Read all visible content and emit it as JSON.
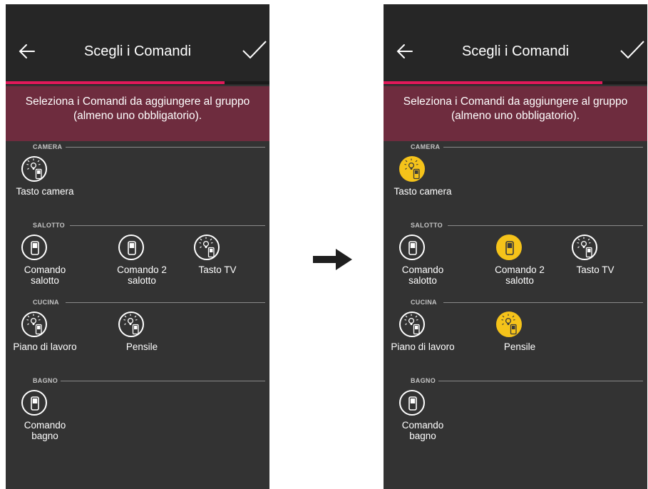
{
  "screens": [
    {
      "title": "Scegli i Comandi",
      "banner": "Seleziona i Comandi da aggiungere al gruppo\n(almeno uno obbligatorio).",
      "progress": 0.83,
      "sections": [
        {
          "name": "CAMERA",
          "items": [
            {
              "label": "Tasto camera",
              "icon": "lamp-switch-icon",
              "selected": false
            }
          ]
        },
        {
          "name": "SALOTTO",
          "items": [
            {
              "label": "Comando\nsalotto",
              "icon": "switch-icon",
              "selected": false
            },
            {
              "label": "Comando 2\nsalotto",
              "icon": "switch-icon",
              "selected": false
            },
            {
              "label": "Tasto TV",
              "icon": "lamp-switch-icon",
              "selected": false
            }
          ]
        },
        {
          "name": "CUCINA",
          "items": [
            {
              "label": "Piano di lavoro",
              "icon": "lamp-switch-icon",
              "selected": false
            },
            {
              "label": "Pensile",
              "icon": "lamp-switch-icon",
              "selected": false
            }
          ]
        },
        {
          "name": "BAGNO",
          "items": [
            {
              "label": "Comando\nbagno",
              "icon": "switch-icon",
              "selected": false
            }
          ]
        }
      ]
    },
    {
      "title": "Scegli i Comandi",
      "banner": "Seleziona i Comandi da aggiungere al gruppo\n(almeno uno obbligatorio).",
      "progress": 0.83,
      "sections": [
        {
          "name": "CAMERA",
          "items": [
            {
              "label": "Tasto camera",
              "icon": "lamp-switch-icon",
              "selected": true
            }
          ]
        },
        {
          "name": "SALOTTO",
          "items": [
            {
              "label": "Comando\nsalotto",
              "icon": "switch-icon",
              "selected": false
            },
            {
              "label": "Comando 2\nsalotto",
              "icon": "switch-icon",
              "selected": true
            },
            {
              "label": "Tasto TV",
              "icon": "lamp-switch-icon",
              "selected": false
            }
          ]
        },
        {
          "name": "CUCINA",
          "items": [
            {
              "label": "Piano di lavoro",
              "icon": "lamp-switch-icon",
              "selected": false
            },
            {
              "label": "Pensile",
              "icon": "lamp-switch-icon",
              "selected": true
            }
          ]
        },
        {
          "name": "BAGNO",
          "items": [
            {
              "label": "Comando\nbagno",
              "icon": "switch-icon",
              "selected": false
            }
          ]
        }
      ]
    }
  ],
  "arrow_icon": "right-arrow-icon",
  "colors": {
    "background": "#333333",
    "header": "#262626",
    "banner": "#6e2c3e",
    "progress": "#e0195a",
    "selected": "#f5c31a"
  }
}
